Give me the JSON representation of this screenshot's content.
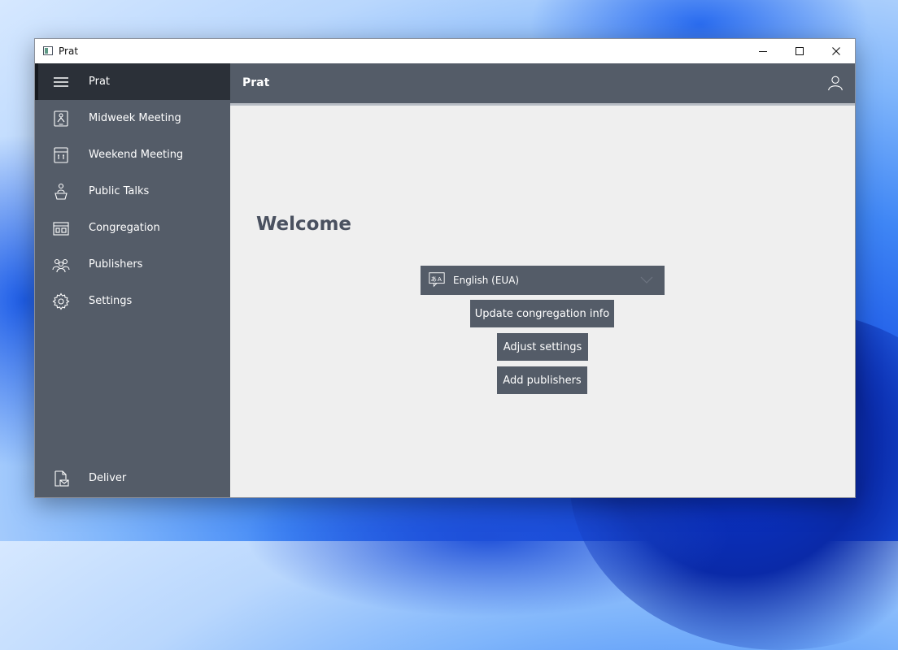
{
  "window": {
    "title": "Prat"
  },
  "sidebar": {
    "items": [
      {
        "label": "Prat",
        "icon": "hamburger-menu-icon"
      },
      {
        "label": "Midweek Meeting",
        "icon": "midweek-meeting-icon"
      },
      {
        "label": "Weekend Meeting",
        "icon": "weekend-meeting-icon"
      },
      {
        "label": "Public Talks",
        "icon": "speaker-podium-icon"
      },
      {
        "label": "Congregation",
        "icon": "congregation-building-icon"
      },
      {
        "label": "Publishers",
        "icon": "people-group-icon"
      },
      {
        "label": "Settings",
        "icon": "gear-icon"
      }
    ],
    "footer_item": {
      "label": "Deliver",
      "icon": "deliver-mail-icon"
    }
  },
  "header": {
    "title": "Prat",
    "icon": "user-account-icon"
  },
  "main": {
    "welcome": "Welcome",
    "language": {
      "selected": "English (EUA)",
      "icon": "language-translate-icon"
    },
    "buttons": {
      "update_congregation": "Update congregation info",
      "adjust_settings": "Adjust settings",
      "add_publishers": "Add publishers"
    }
  },
  "colors": {
    "sidebar_bg": "#545c68",
    "sidebar_active": "#2b3038",
    "content_bg": "#efefef",
    "accent_text": "#4a5160"
  }
}
